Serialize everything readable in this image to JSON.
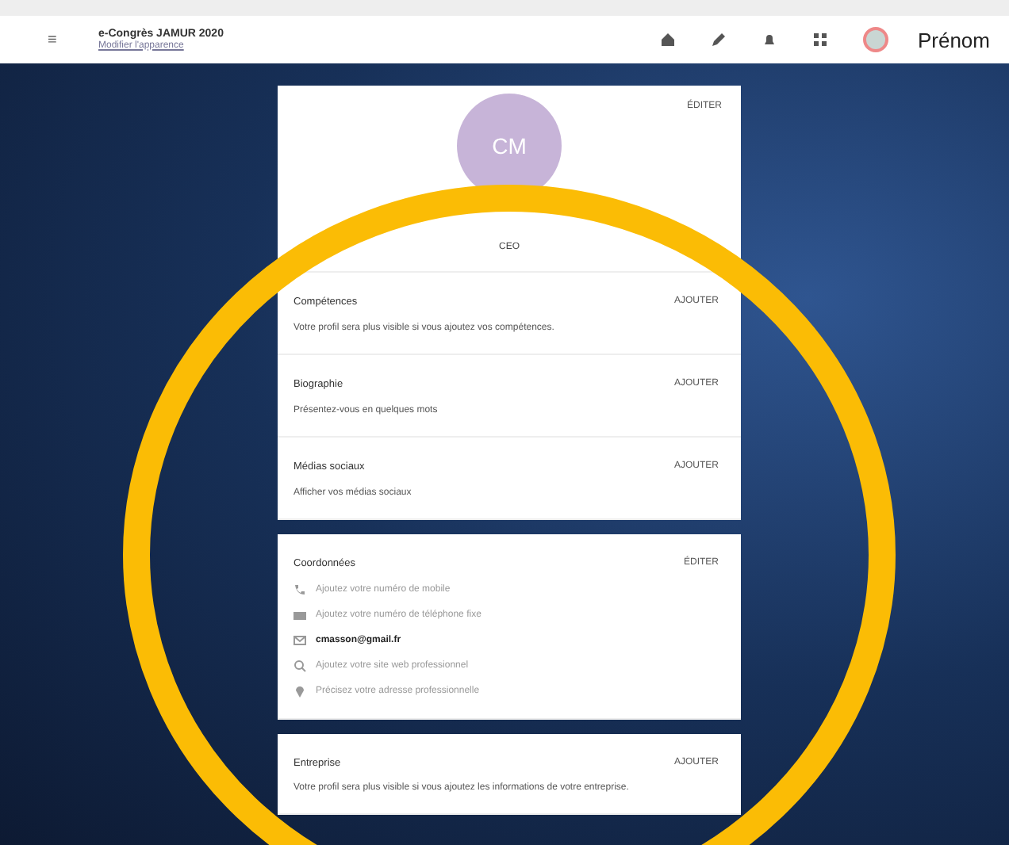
{
  "header": {
    "menu_icon": "≡",
    "event_title": "e-Congrès JAMUR 2020",
    "event_subtitle": "Modifier l'apparence",
    "user_name": "Prénom"
  },
  "profile": {
    "initials": "CM",
    "role": "CEO",
    "action": "ÉDITER"
  },
  "sections": [
    {
      "title": "Compétences",
      "action": "AJOUTER",
      "text": "Votre profil sera plus visible si vous ajoutez vos compétences."
    },
    {
      "title": "Biographie",
      "action": "AJOUTER",
      "text": "Présentez-vous en quelques mots"
    },
    {
      "title": "Médias sociaux",
      "action": "AJOUTER",
      "text": "Afficher vos médias sociaux"
    }
  ],
  "contact": {
    "title": "Coordonnées",
    "action": "ÉDITER",
    "items": [
      {
        "kind": "phone",
        "text": "Ajoutez votre numéro de mobile",
        "filled": false
      },
      {
        "kind": "fax",
        "text": "Ajoutez votre numéro de téléphone fixe",
        "filled": false
      },
      {
        "kind": "mail",
        "text": "cmasson@gmail.fr",
        "filled": true
      },
      {
        "kind": "web",
        "text": "Ajoutez votre site web professionnel",
        "filled": false
      },
      {
        "kind": "pin",
        "text": "Précisez votre adresse professionnelle",
        "filled": false
      }
    ]
  },
  "company": {
    "title": "Entreprise",
    "action": "AJOUTER",
    "text": "Votre profil sera plus visible si vous ajoutez les informations de votre entreprise."
  }
}
